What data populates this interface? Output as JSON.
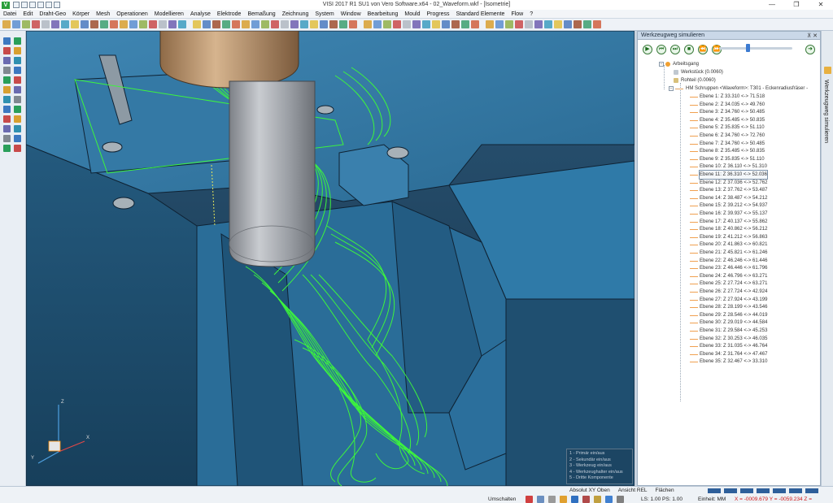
{
  "titlebar": {
    "app_icon_letter": "V",
    "title": "VISI 2017 R1 SU1 von Vero Software.x64 - 02_Waveform.wkf - [Isometrie]",
    "min": "—",
    "max": "❐",
    "close": "✕"
  },
  "menu": [
    "Datei",
    "Edit",
    "Draht-Geo",
    "Körper",
    "Mesh",
    "Operationen",
    "Modellieren",
    "Analyse",
    "Elektrode",
    "Bemaßung",
    "Zeichnung",
    "System",
    "Window",
    "Bearbeitung",
    "Mould",
    "Progress",
    "Standard Elemente",
    "Flow",
    "?"
  ],
  "panel": {
    "title": "Werkzeugweg simulieren",
    "pin": "⊼ ✕",
    "controls": {
      "play": "▶",
      "back": "⏮",
      "fwd": "⏭",
      "stop": "■",
      "first": "⏪",
      "last": "⏩",
      "go": "➜"
    },
    "slider_fraction": 0.37,
    "tree": {
      "root": "Arbeitsgang",
      "werkstueck": "Werkstück (0.0060)",
      "rohteil": "Rohteil (0.0060)",
      "op": "HM Schruppen <Waveform>: T301 - Eckenradiusfräser -",
      "ebenen": [
        "Ebene 1: Z 33.310 <-> 71.518",
        "Ebene 2: Z 34.035 <-> 49.760",
        "Ebene 3: Z 34.760 <-> 50.485",
        "Ebene 4: Z 35.485 <-> 50.835",
        "Ebene 5: Z 35.835 <-> 51.110",
        "Ebene 6: Z 34.760 <-> 72.760",
        "Ebene 7: Z 34.760 <-> 50.485",
        "Ebene 8: Z 35.485 <-> 50.835",
        "Ebene 9: Z 35.835 <-> 51.110",
        "Ebene 10: Z 36.110 <-> 51.310",
        "Ebene 11: Z 36.310 <-> 52.036",
        "Ebene 12: Z 37.036 <-> 52.762",
        "Ebene 13: Z 37.762 <-> 53.487",
        "Ebene 14: Z 38.487 <-> 54.212",
        "Ebene 15: Z 39.212 <-> 54.937",
        "Ebene 16: Z 39.937 <-> 55.137",
        "Ebene 17: Z 40.137 <-> 55.862",
        "Ebene 18: Z 40.862 <-> 56.212",
        "Ebene 19: Z 41.212 <-> 56.863",
        "Ebene 20: Z 41.863 <-> 60.821",
        "Ebene 21: Z 45.821 <-> 61.246",
        "Ebene 22: Z 46.246 <-> 61.446",
        "Ebene 23: Z 46.446 <-> 61.796",
        "Ebene 24: Z 46.796 <-> 63.271",
        "Ebene 25: Z 27.724 <-> 63.271",
        "Ebene 26: Z 27.724 <-> 42.924",
        "Ebene 27: Z 27.924 <-> 43.199",
        "Ebene 28: Z 28.199 <-> 43.546",
        "Ebene 29: Z 28.546 <-> 44.019",
        "Ebene 30: Z 29.019 <-> 44.584",
        "Ebene 31: Z 29.584 <-> 45.253",
        "Ebene 32: Z 30.253 <-> 46.035",
        "Ebene 33: Z 31.035 <-> 46.764",
        "Ebene 34: Z 31.764 <-> 47.467",
        "Ebene 35: Z 32.467 <-> 33.310"
      ],
      "selected_index": 10
    }
  },
  "vtab_label": "Werkzeugweg simulieren",
  "legend": [
    "1 - Primär ein/aus",
    "2 - Sekundär ein/aus",
    "3 - Werkzeug ein/aus",
    "4 - Werkzeughalter ein/aus",
    "5 - Dritte Komponente"
  ],
  "axes": {
    "x": "X",
    "y": "Y",
    "z": "Z"
  },
  "status": {
    "top": [
      "Absolut XY Oben",
      "Ansicht REL",
      "Flächen"
    ],
    "umschalten": "Umschalten",
    "ls": "LS: 1.00 PS: 1.00",
    "einheit": "Einheit: MM",
    "coords": "X = -0009.679 Y = -0059.234 Z = 0000.000"
  },
  "colors": {
    "model": "#2e6f96",
    "toolpath": "#3df53d",
    "background_top": "#1d3b52",
    "holder": "#c9a37a",
    "tool": "#a8acb2",
    "coord_red": "#d01818"
  }
}
